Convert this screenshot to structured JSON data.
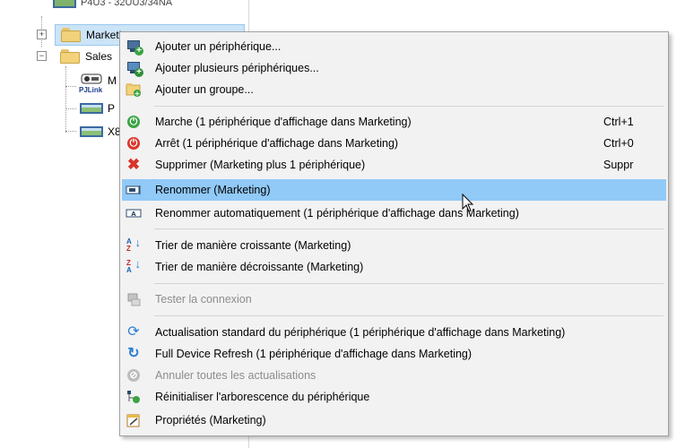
{
  "tree": {
    "items": [
      {
        "label": "P4U3 - 32UU3/34NA",
        "type": "projector"
      },
      {
        "label": "Marketing",
        "type": "folder",
        "expander": "+"
      },
      {
        "label": "Sales",
        "type": "folder",
        "expander": "−"
      },
      {
        "label": "M",
        "type": "pjlink",
        "badge": "PJLink"
      },
      {
        "label": "P",
        "type": "projector"
      },
      {
        "label": "X8",
        "type": "projector"
      }
    ]
  },
  "menu": {
    "items": [
      {
        "label": "Ajouter un périphérique...",
        "icon": "add-device-icon"
      },
      {
        "label": "Ajouter plusieurs périphériques...",
        "icon": "add-multiple-devices-icon"
      },
      {
        "label": "Ajouter un groupe...",
        "icon": "add-group-icon"
      },
      {
        "label": "Marche  (1 périphérique d'affichage dans Marketing)",
        "shortcut": "Ctrl+1",
        "icon": "power-on-icon"
      },
      {
        "label": "Arrêt  (1 périphérique d'affichage dans Marketing)",
        "shortcut": "Ctrl+0",
        "icon": "power-off-icon"
      },
      {
        "label": "Supprimer  (Marketing plus 1 périphérique)",
        "shortcut": "Suppr",
        "icon": "delete-icon"
      },
      {
        "label": "Renommer  (Marketing)",
        "icon": "rename-icon",
        "highlighted": true
      },
      {
        "label": "Renommer automatiquement  (1 périphérique d'affichage dans Marketing)",
        "icon": "auto-rename-icon"
      },
      {
        "label": "Trier de manière croissante  (Marketing)",
        "icon": "sort-ascending-icon"
      },
      {
        "label": "Trier de manière décroissante  (Marketing)",
        "icon": "sort-descending-icon"
      },
      {
        "label": "Tester la connexion",
        "icon": "test-connection-icon",
        "disabled": true
      },
      {
        "label": "Actualisation standard du périphérique  (1 périphérique d'affichage dans Marketing)",
        "icon": "refresh-icon"
      },
      {
        "label": "Full Device Refresh  (1 périphérique d'affichage dans Marketing)",
        "icon": "full-refresh-icon"
      },
      {
        "label": "Annuler toutes les actualisations",
        "icon": "cancel-refresh-icon",
        "disabled": true
      },
      {
        "label": "Réinitialiser l'arborescence du périphérique",
        "icon": "reset-tree-icon"
      },
      {
        "label": "Propriétés  (Marketing)",
        "icon": "properties-icon"
      }
    ]
  },
  "colors": {
    "highlight": "#91c9f7",
    "menu_bg": "#f2f2f2",
    "power_on": "#3aa442",
    "power_off": "#d9372b",
    "delete": "#d8342a",
    "disabled_text": "#8d8d8d"
  }
}
